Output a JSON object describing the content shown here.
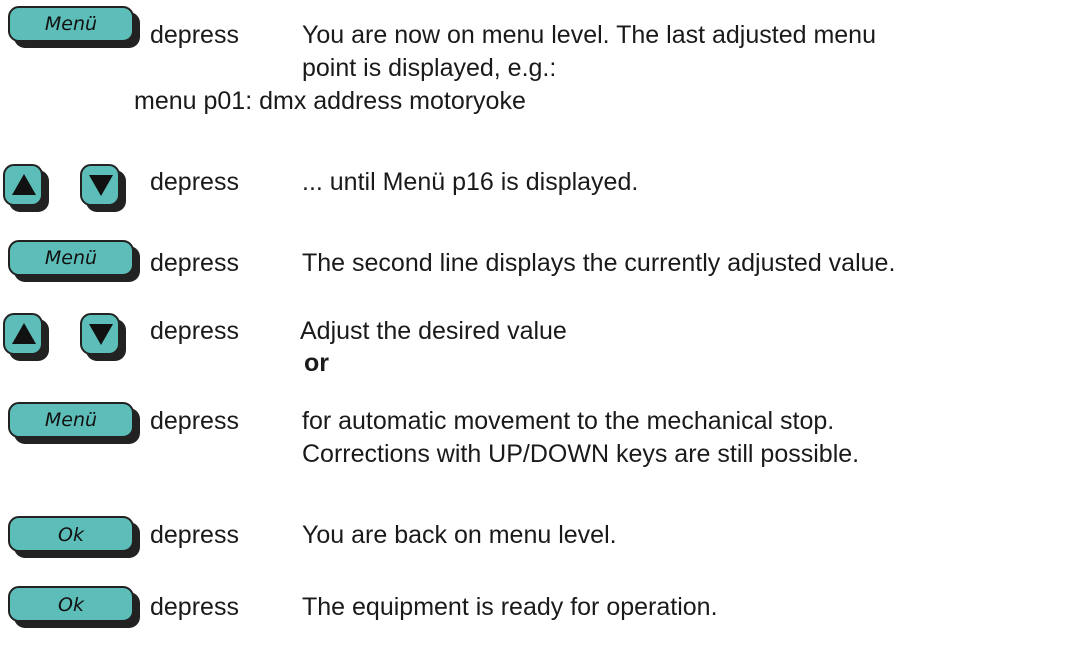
{
  "keys": {
    "menu": "Menü",
    "ok": "Ok",
    "up_icon": "arrow-up-icon",
    "down_icon": "arrow-down-icon"
  },
  "depress": "depress",
  "steps": [
    {
      "key": "Menü",
      "lines": [
        "You are now on menu level. The last adjusted menu",
        "point is displayed, e.g.:"
      ],
      "example": "menu p01: dmx address motoryoke"
    },
    {
      "key": "up-down",
      "lines": [
        "... until Menü p16 is displayed."
      ]
    },
    {
      "key": "Menü",
      "lines": [
        "The second line displays the currently adjusted value."
      ]
    },
    {
      "key": "up-down",
      "lines": [
        "Adjust the desired value"
      ],
      "or": "or"
    },
    {
      "key": "Menü",
      "lines": [
        "for automatic movement to the mechanical stop.",
        "Corrections with UP/DOWN keys are still possible."
      ]
    },
    {
      "key": "Ok",
      "lines": [
        "You are back on menu level."
      ]
    },
    {
      "key": "Ok",
      "lines": [
        "The equipment is ready for operation."
      ]
    }
  ],
  "colors": {
    "key_fill": "#5dbdb8",
    "key_border": "#222222"
  }
}
